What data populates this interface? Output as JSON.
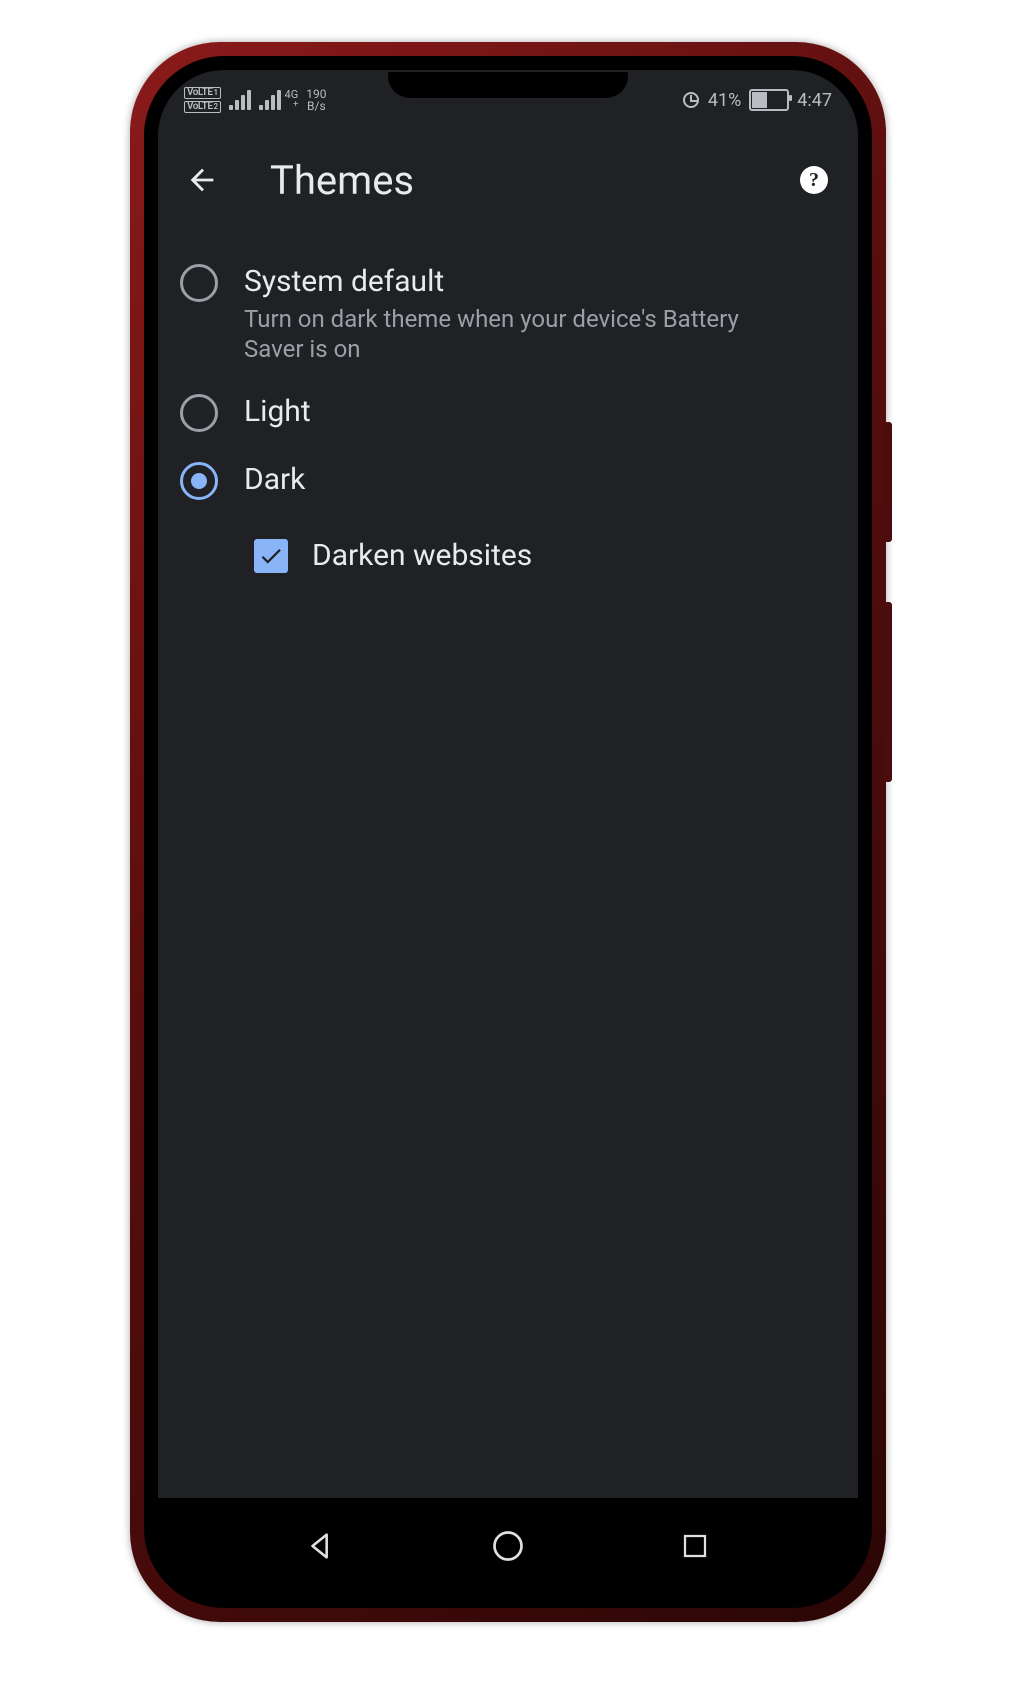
{
  "status_bar": {
    "volte1": "VoLTE",
    "volte1_sub": "1",
    "volte2": "VoLTE",
    "volte2_sub": "2",
    "net_tech_top": "4G",
    "net_tech_bot": "+",
    "speed_value": "190",
    "speed_unit": "B/s",
    "battery_pct": "41%",
    "time": "4:47"
  },
  "header": {
    "title": "Themes"
  },
  "options": {
    "system_default": {
      "title": "System default",
      "subtitle": "Turn on dark theme when your device's Battery Saver is on",
      "selected": false
    },
    "light": {
      "title": "Light",
      "selected": false
    },
    "dark": {
      "title": "Dark",
      "selected": true
    }
  },
  "darken_websites": {
    "label": "Darken websites",
    "checked": true
  }
}
